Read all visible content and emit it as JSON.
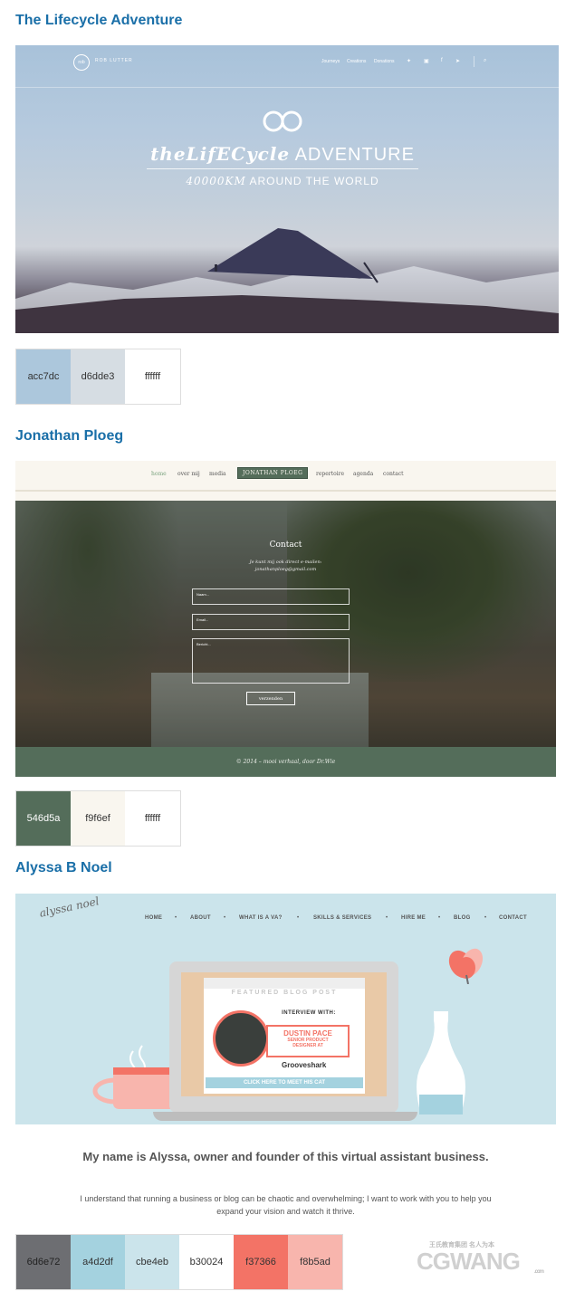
{
  "sections": [
    {
      "title": "The Lifecycle Adventure",
      "colors": [
        "acc7dc",
        "d6dde3",
        "ffffff"
      ],
      "site": {
        "brand": "ROB LUTTER",
        "nav": [
          "Journeys",
          "Creations",
          "Donations"
        ],
        "hero_script": "theLifECycle",
        "hero_word": "ADVENTURE",
        "hero_sub_italic": "40000KM",
        "hero_sub": "AROUND THE WORLD"
      }
    },
    {
      "title": "Jonathan Ploeg",
      "colors": [
        "546d5a",
        "f9f6ef",
        "ffffff"
      ],
      "site": {
        "nav": [
          "home",
          "over mij",
          "media",
          "JONATHAN PLOEG",
          "repertoire",
          "agenda",
          "contact"
        ],
        "contact_title": "Contact",
        "contact_line1": "Je kunt mij ook direct e-mailen:",
        "contact_line2": "jonathanploeg@gmail.com",
        "field_name": "Naam...",
        "field_email": "Email...",
        "field_message": "Bericht...",
        "send": "verzenden",
        "footer": "© 2014 – mooi verhaal, door Dr.Wie"
      }
    },
    {
      "title": "Alyssa B Noel",
      "colors": [
        "6d6e72",
        "a4d2df",
        "cbe4eb",
        "b30024",
        "f37366",
        "f8b5ad"
      ],
      "site": {
        "logo": "alyssa noel",
        "nav": [
          "HOME",
          "ABOUT",
          "WHAT IS A VA?",
          "SKILLS & SERVICES",
          "HIRE ME",
          "BLOG",
          "CONTACT"
        ],
        "featured": "FEATURED BLOG POST",
        "interview": "INTERVIEW WITH:",
        "name": "DUSTIN PACE",
        "role1": "SENIOR PRODUCT",
        "role2": "DESIGNER AT",
        "company": "Grooveshark",
        "cta": "CLICK HERE TO MEET HIS CAT",
        "tagline": "My name is Alyssa, owner and founder of this virtual assistant business.",
        "body1": "I understand that running a business or blog can be chaotic and overwhelming; I want to work with you to help you",
        "body2": "expand your vision and watch it thrive."
      }
    }
  ],
  "watermark": {
    "text": "CGWANG",
    "small": "王氏教育集团 名人为本",
    "domain": ".com"
  }
}
